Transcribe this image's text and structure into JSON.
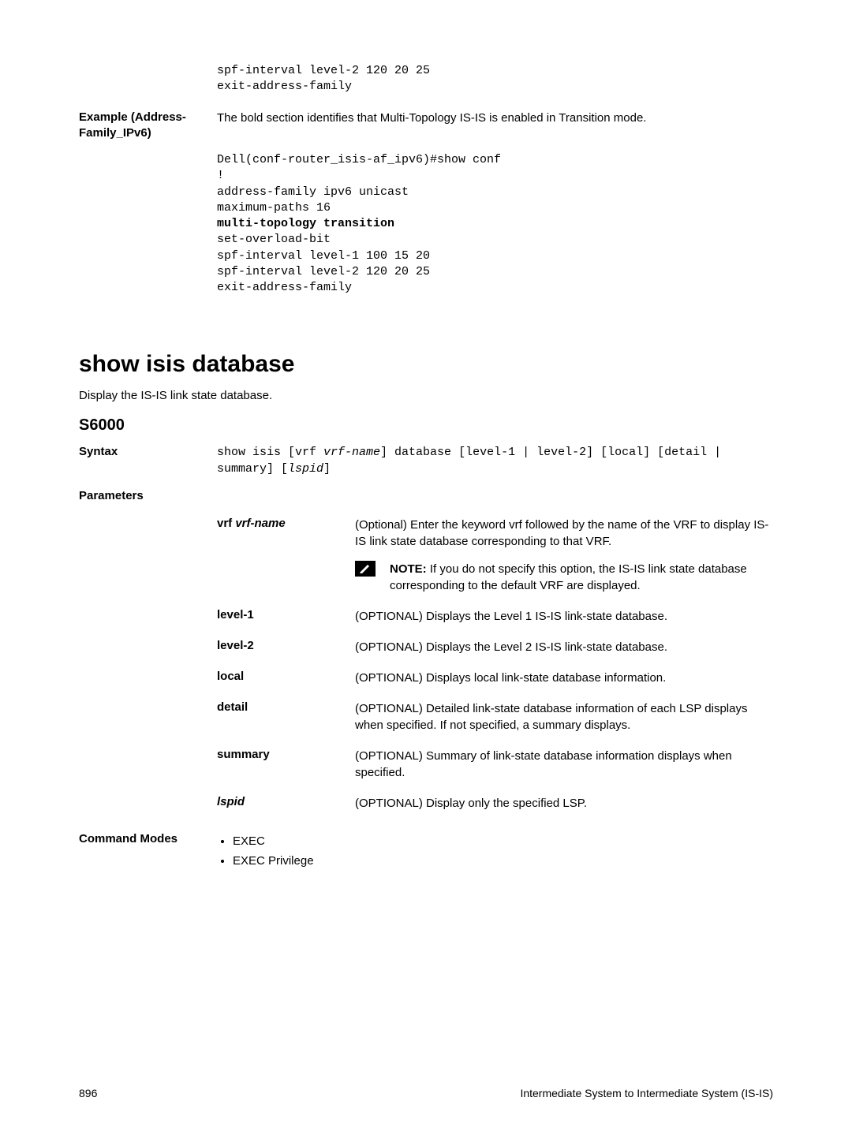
{
  "top_code": "spf-interval level-2 120 20 25\nexit-address-family",
  "example_label": "Example (Address-Family_IPv6)",
  "example_intro": "The bold section identifies that Multi-Topology IS-IS is enabled in Transition mode.",
  "example_code_pre": "Dell(conf-router_isis-af_ipv6)#show conf\n!\naddress-family ipv6 unicast\nmaximum-paths 16\n",
  "example_code_bold": "multi-topology transition",
  "example_code_post": "\nset-overload-bit\nspf-interval level-1 100 15 20\nspf-interval level-2 120 20 25\nexit-address-family",
  "section_title": "show isis database",
  "section_desc": "Display the IS-IS link state database.",
  "sub_title": "S6000",
  "syntax_label": "Syntax",
  "syntax_text_parts": {
    "p1": "show isis [vrf ",
    "p2": "vrf-name",
    "p3": "] database [level-1 | level-2] [local] [detail | summary] [",
    "p4": "lspid",
    "p5": "]"
  },
  "parameters_label": "Parameters",
  "params": [
    {
      "name_html": "vrf <i>vrf-name</i>",
      "name_plain": "vrf ",
      "name_italic": "vrf-name",
      "desc": "(Optional) Enter the keyword vrf followed by the name of the VRF to display IS-IS link state database corresponding to that VRF.",
      "has_note": true,
      "note_label": "NOTE: ",
      "note_text": "If you do not specify this option, the IS-IS link state database corresponding to the default VRF are displayed."
    },
    {
      "name_plain": "level-1",
      "desc": "(OPTIONAL) Displays the Level 1 IS-IS link-state database."
    },
    {
      "name_plain": "level-2",
      "desc": "(OPTIONAL) Displays the Level 2 IS-IS link-state database."
    },
    {
      "name_plain": "local",
      "desc": "(OPTIONAL) Displays local link-state database information."
    },
    {
      "name_plain": "detail",
      "desc": "(OPTIONAL) Detailed link-state database information of each LSP displays when specified. If not specified, a summary displays."
    },
    {
      "name_plain": "summary",
      "desc": "(OPTIONAL) Summary of link-state database information displays when specified."
    },
    {
      "name_italic_only": "lspid",
      "desc": "(OPTIONAL) Display only the specified LSP."
    }
  ],
  "command_modes_label": "Command Modes",
  "command_modes": [
    "EXEC",
    "EXEC Privilege"
  ],
  "page_number": "896",
  "footer_text": "Intermediate System to Intermediate System (IS-IS)"
}
